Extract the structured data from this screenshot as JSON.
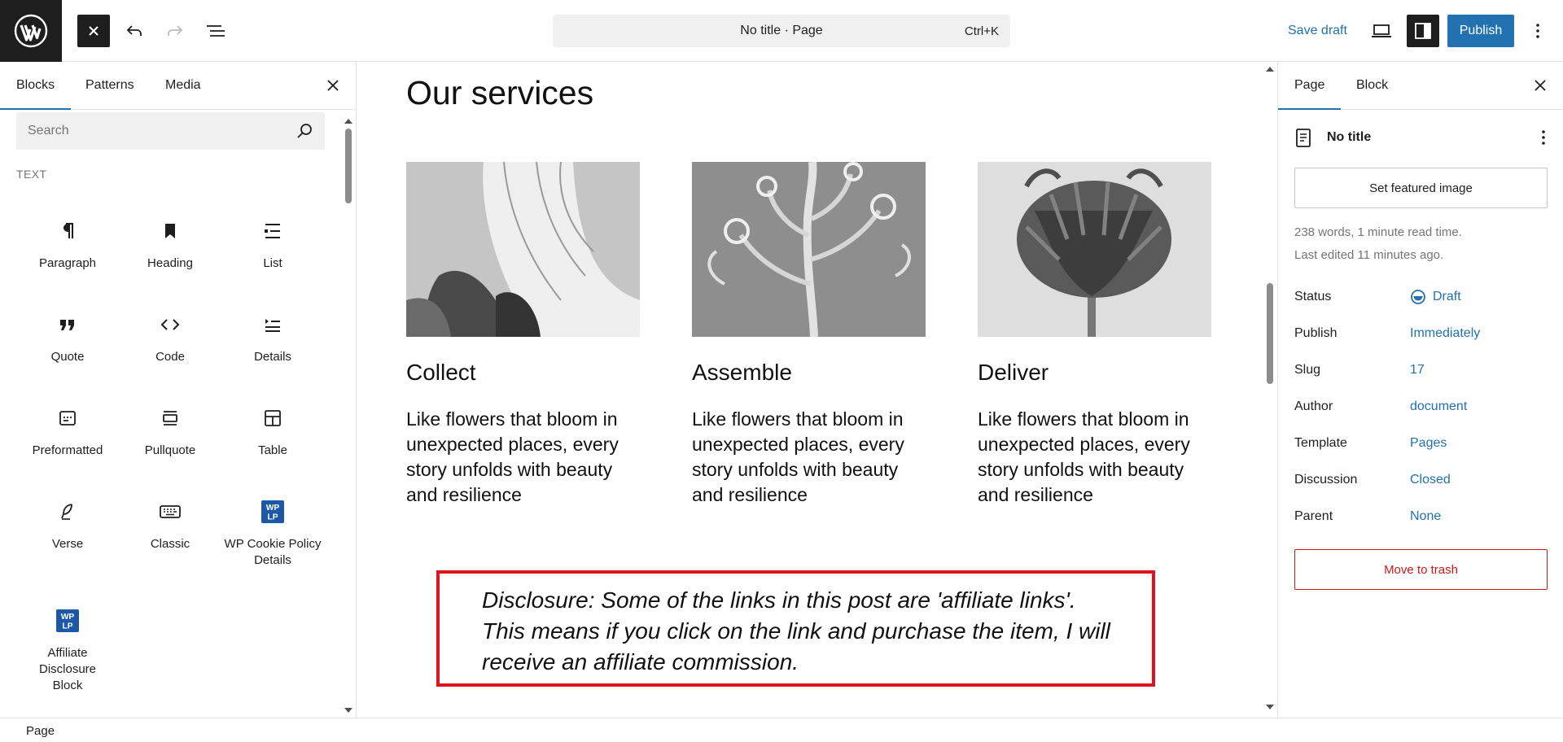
{
  "topbar": {
    "logo_icon": "wordpress-logo",
    "close_inserter_icon": "close-icon",
    "undo_icon": "undo-icon",
    "redo_icon": "redo-icon",
    "document_overview_icon": "list-view-icon",
    "command_bar": {
      "title": "No title · Page",
      "shortcut": "Ctrl+K"
    },
    "save_draft_label": "Save draft",
    "preview_icon": "desktop-icon",
    "settings_icon": "sidebar-icon",
    "publish_label": "Publish",
    "options_icon": "more-vertical-icon",
    "accent_color": "#2271b1"
  },
  "inserter": {
    "tabs": [
      {
        "label": "Blocks",
        "active": true
      },
      {
        "label": "Patterns",
        "active": false
      },
      {
        "label": "Media",
        "active": false
      }
    ],
    "search_placeholder": "Search",
    "section_label": "TEXT",
    "blocks": [
      {
        "label": "Paragraph",
        "icon": "paragraph-icon"
      },
      {
        "label": "Heading",
        "icon": "heading-icon"
      },
      {
        "label": "List",
        "icon": "list-icon"
      },
      {
        "label": "Quote",
        "icon": "quote-icon"
      },
      {
        "label": "Code",
        "icon": "code-icon"
      },
      {
        "label": "Details",
        "icon": "details-icon"
      },
      {
        "label": "Preformatted",
        "icon": "preformatted-icon"
      },
      {
        "label": "Pullquote",
        "icon": "pullquote-icon"
      },
      {
        "label": "Table",
        "icon": "table-icon"
      },
      {
        "label": "Verse",
        "icon": "verse-icon"
      },
      {
        "label": "Classic",
        "icon": "keyboard-icon"
      },
      {
        "label": "WP Cookie Policy Details",
        "icon": "wplp-icon"
      },
      {
        "label": "Affiliate Disclosure Block",
        "icon": "wplp-icon"
      }
    ],
    "wplp_badge_text": "WP\nLP"
  },
  "canvas": {
    "heading": "Our services",
    "services": [
      {
        "title": "Collect",
        "text": "Like flowers that bloom in unexpected places, every story unfolds with beauty and resilience",
        "image": "bell-flower-photo"
      },
      {
        "title": "Assemble",
        "text": "Like flowers that bloom in unexpected places, every story unfolds with beauty and resilience",
        "image": "curled-plant-photo"
      },
      {
        "title": "Deliver",
        "text": "Like flowers that bloom in unexpected places, every story unfolds with beauty and resilience",
        "image": "artichoke-photo"
      }
    ],
    "disclosure": "Disclosure: Some of the links in this post are 'affiliate links'. This means if you click on the link and purchase the item, I will receive an affiliate commission.",
    "disclosure_border_color": "#e0141e"
  },
  "sidebar": {
    "tabs": [
      {
        "label": "Page",
        "active": true
      },
      {
        "label": "Block",
        "active": false
      }
    ],
    "document_title": "No title",
    "featured_image_label": "Set featured image",
    "word_count": "238 words, 1 minute read time.",
    "last_edited": "Last edited 11 minutes ago.",
    "properties": [
      {
        "label": "Status",
        "value": "Draft"
      },
      {
        "label": "Publish",
        "value": "Immediately"
      },
      {
        "label": "Slug",
        "value": "17"
      },
      {
        "label": "Author",
        "value": "document"
      },
      {
        "label": "Template",
        "value": "Pages"
      },
      {
        "label": "Discussion",
        "value": "Closed"
      },
      {
        "label": "Parent",
        "value": "None"
      }
    ],
    "trash_label": "Move to trash",
    "danger_color": "#cc1818"
  },
  "footer": {
    "breadcrumb": "Page"
  }
}
